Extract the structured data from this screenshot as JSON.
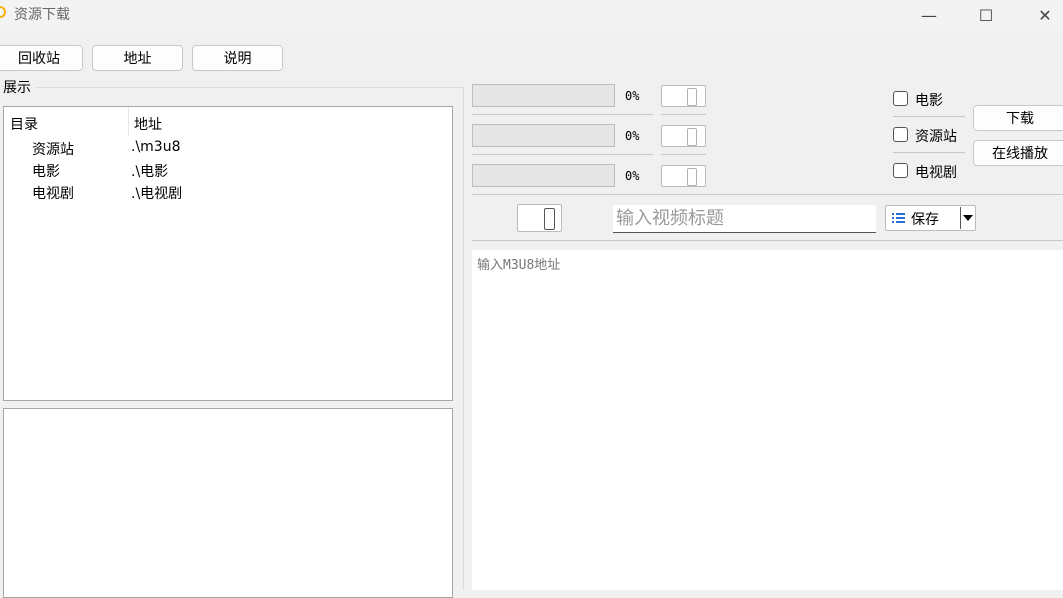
{
  "window": {
    "title": "资源下载",
    "minimize": "—",
    "maximize": "☐",
    "close": "✕"
  },
  "toolbar": {
    "recycle_label": "回收站",
    "address_label": "地址",
    "help_label": "说明"
  },
  "group": {
    "label": "展示"
  },
  "list": {
    "columns": [
      "目录",
      "地址"
    ],
    "rows": [
      {
        "name": "资源站",
        "path": ".\\m3u8"
      },
      {
        "name": "电影",
        "path": ".\\电影"
      },
      {
        "name": "电视剧",
        "path": ".\\电视剧"
      }
    ]
  },
  "downloads": [
    {
      "progress": 0,
      "percent_text": "0%"
    },
    {
      "progress": 0,
      "percent_text": "0%"
    },
    {
      "progress": 0,
      "percent_text": "0%"
    }
  ],
  "categories": [
    {
      "label": "电影",
      "checked": false
    },
    {
      "label": "资源站",
      "checked": false
    },
    {
      "label": "电视剧",
      "checked": false
    }
  ],
  "actions": {
    "download_label": "下载",
    "play_online_label": "在线播放"
  },
  "title_input": {
    "placeholder": "输入视频标题",
    "value": ""
  },
  "save": {
    "label": "保存",
    "icon": "list-icon"
  },
  "url_input": {
    "placeholder": "输入M3U8地址",
    "value": ""
  }
}
